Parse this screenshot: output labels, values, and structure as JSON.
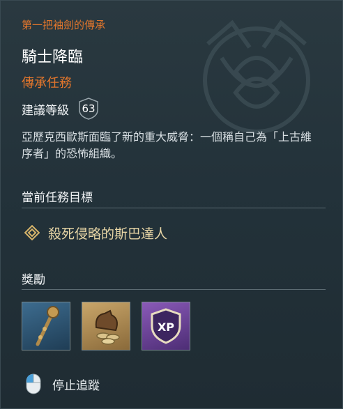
{
  "quest": {
    "questline": "第一把袖劍的傳承",
    "title": "騎士降臨",
    "type": "傳承任務",
    "level_label": "建議等級",
    "level": "63",
    "description": "亞歷克西歐斯面臨了新的重大威脅：一個稱自己為「上古維序者」的恐怖組織。"
  },
  "objectives": {
    "heading": "當前任務目標",
    "items": [
      {
        "text": "殺死侵略的斯巴達人",
        "icon": "objective-diamond-icon"
      }
    ]
  },
  "rewards": {
    "heading": "獎勵",
    "items": [
      {
        "icon": "mace-weapon-icon"
      },
      {
        "icon": "drachmae-money-icon"
      },
      {
        "icon": "xp-icon",
        "text": "XP"
      }
    ]
  },
  "footer": {
    "action_label": "停止追蹤",
    "icon": "mouse-icon"
  },
  "colors": {
    "accent_orange": "#e2762c",
    "objective_gold": "#e8d6a6",
    "panel_bg": "#23323a"
  }
}
